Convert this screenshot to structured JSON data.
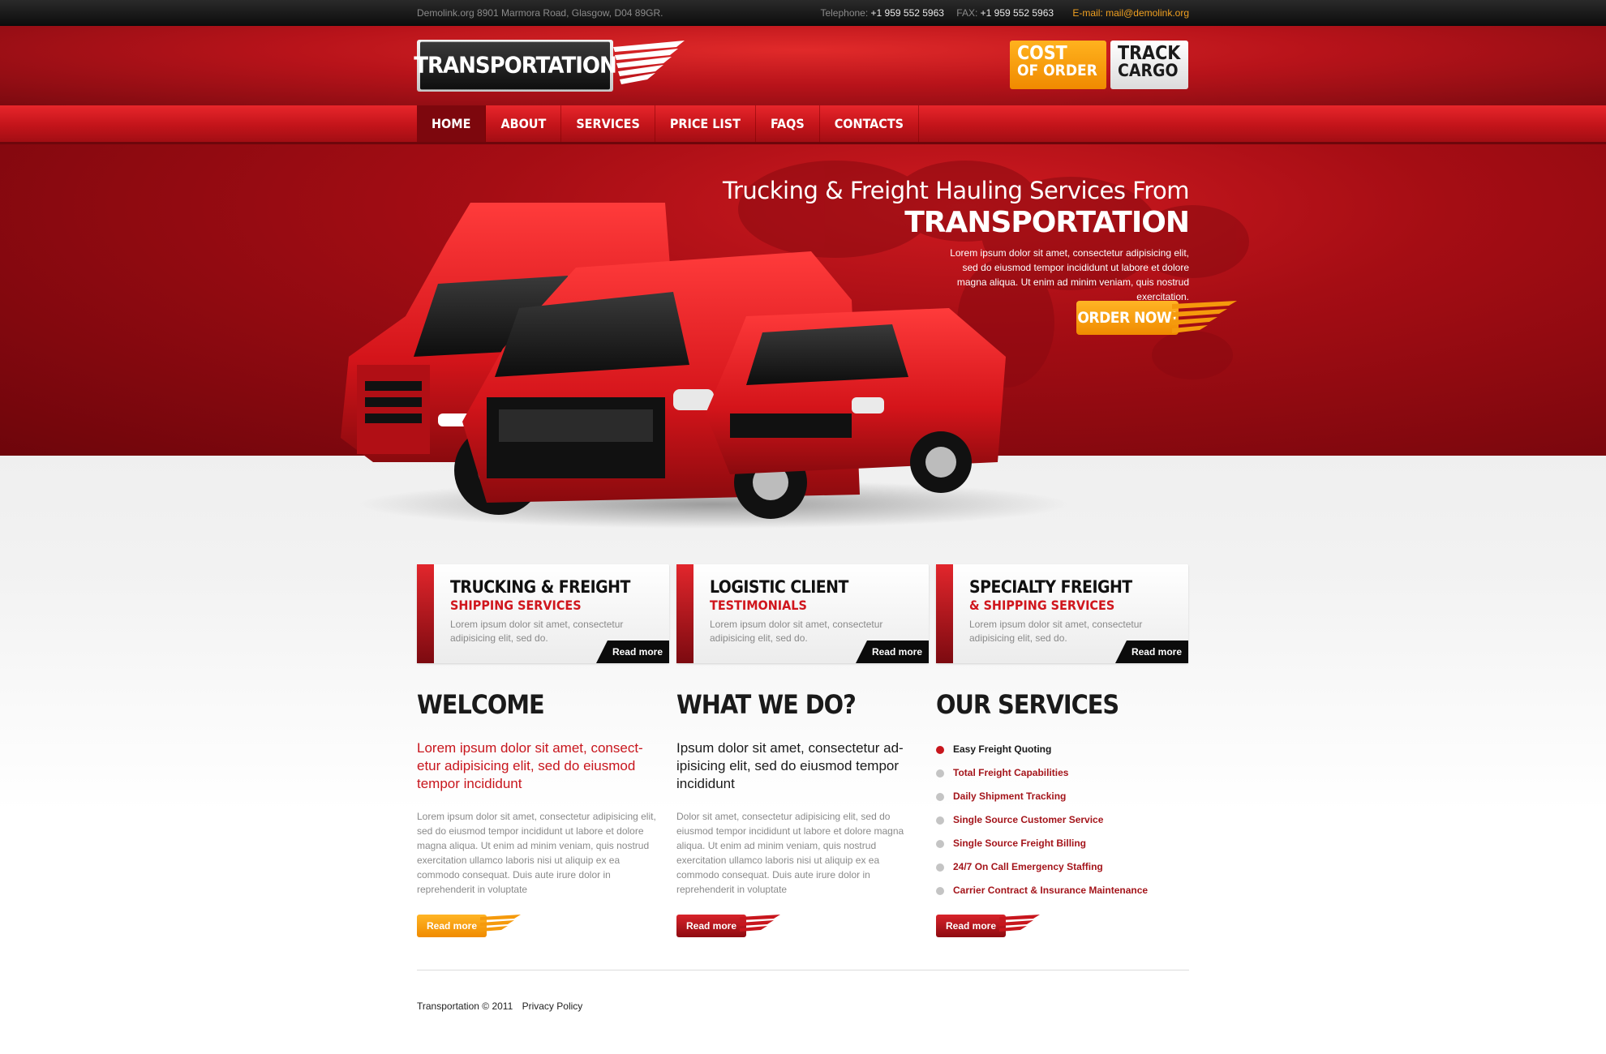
{
  "topbar": {
    "address": "Demolink.org  8901 Marmora Road, Glasgow,  D04 89GR.",
    "telephone_label": "Telephone:",
    "telephone": "+1 959 552 5963",
    "fax_label": "FAX:",
    "fax": "+1 959 552 5963",
    "email_label": "E-mail:",
    "email": "mail@demolink.org"
  },
  "header": {
    "logo_text": "TRANSPORTATION",
    "cost_line1": "COST",
    "cost_line2": "OF ORDER",
    "track_line1": "TRACK",
    "track_line2": "CARGO"
  },
  "nav": {
    "items": [
      "HOME",
      "ABOUT",
      "SERVICES",
      "PRICE LIST",
      "FAQS",
      "CONTACTS"
    ],
    "active": "HOME"
  },
  "hero": {
    "subtitle": "Trucking & Freight Hauling Services   From",
    "title": "TRANSPORTATION",
    "description": "Lorem ipsum dolor sit amet, consectetur adipisicing elit, sed do eiusmod tempor incididunt ut labore et dolore magna aliqua. Ut enim ad minim veniam, quis nostrud exercitation.",
    "order_label": "ORDER NOW!"
  },
  "boxes": [
    {
      "title": "TRUCKING & FREIGHT",
      "subtitle": "SHIPPING SERVICES",
      "text": "Lorem ipsum dolor sit amet, consectetur adipisicing elit, sed do.",
      "button": "Read more"
    },
    {
      "title": "LOGISTIC CLIENT",
      "subtitle": "TESTIMONIALS",
      "text": "Lorem ipsum dolor sit amet, consectetur adipisicing elit, sed do.",
      "button": "Read more"
    },
    {
      "title": "SPECIALTY FREIGHT",
      "subtitle": "& SHIPPING SERVICES",
      "text": "Lorem ipsum dolor sit amet, consectetur adipisicing elit, sed do.",
      "button": "Read more"
    }
  ],
  "welcome": {
    "heading": "WELCOME",
    "lead": "Lorem ipsum dolor sit amet, consect-etur adipisicing elit, sed do eiusmod tempor incididunt",
    "body": "Lorem ipsum dolor sit amet, consectetur adipisicing elit, sed do eiusmod tempor incididunt ut labore et dolore magna aliqua. Ut enim ad minim veniam, quis nostrud exercitation ullamco laboris nisi ut aliquip ex ea commodo consequat. Duis aute irure dolor in reprehenderit in voluptate",
    "button": "Read more"
  },
  "whatwedo": {
    "heading": "WHAT WE DO?",
    "lead": "Ipsum dolor sit amet, consectetur ad-ipisicing elit, sed do eiusmod tempor incididunt",
    "body": "Dolor sit amet, consectetur adipisicing elit, sed do eiusmod tempor incididunt ut labore et dolore magna aliqua. Ut enim ad minim veniam, quis nostrud exercitation ullamco laboris nisi ut aliquip ex ea commodo consequat. Duis aute irure dolor in reprehenderit in voluptate",
    "button": "Read more"
  },
  "services": {
    "heading": "OUR SERVICES",
    "items": [
      "Easy Freight Quoting",
      "Total Freight Capabilities",
      "Daily Shipment Tracking",
      "Single Source Customer Service",
      "Single Source Freight Billing",
      "24/7 On Call Emergency Staffing",
      "Carrier Contract & Insurance Maintenance"
    ],
    "button": "Read more"
  },
  "footer": {
    "copyright": "Transportation  © 2011",
    "privacy": "Privacy Policy"
  },
  "colors": {
    "brand_red": "#c8161d",
    "accent_orange": "#f59a0c",
    "dark": "#111111"
  }
}
